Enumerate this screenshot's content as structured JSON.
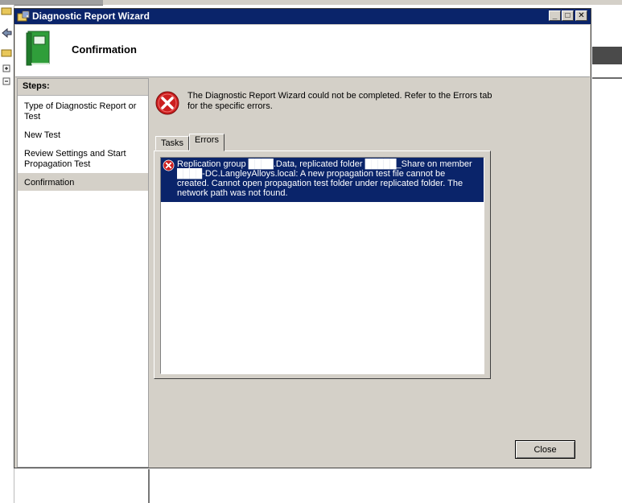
{
  "window": {
    "title": "Diagnostic Report Wizard",
    "buttons": {
      "minimize": "_",
      "maximize": "□",
      "close": "✕"
    }
  },
  "header": {
    "title": "Confirmation"
  },
  "sidebar": {
    "heading": "Steps:",
    "items": [
      {
        "label": "Type of Diagnostic Report or Test"
      },
      {
        "label": "New Test"
      },
      {
        "label": "Review Settings and Start Propagation Test"
      },
      {
        "label": "Confirmation",
        "active": true
      }
    ]
  },
  "main": {
    "message": "The Diagnostic Report Wizard could not be completed. Refer to the Errors tab for the specific errors.",
    "tabs": [
      {
        "label": "Tasks"
      },
      {
        "label": "Errors",
        "selected": true
      }
    ],
    "errors": [
      {
        "text": "Replication group ████.Data, replicated folder █████_Share on member ████-DC.LangleyAlloys.local: A new propagation test file cannot be created. Cannot open propagation test folder under replicated folder. The network path was not found."
      }
    ]
  },
  "footer": {
    "close_label": "Close"
  },
  "colors": {
    "titlebar": "#0a246a",
    "face": "#d4d0c8",
    "selection": "#0a246a",
    "error": "#cc1f1f"
  },
  "icons": {
    "window": "folder-wizard-icon",
    "header": "green-book-icon",
    "error": "error-x-icon"
  }
}
